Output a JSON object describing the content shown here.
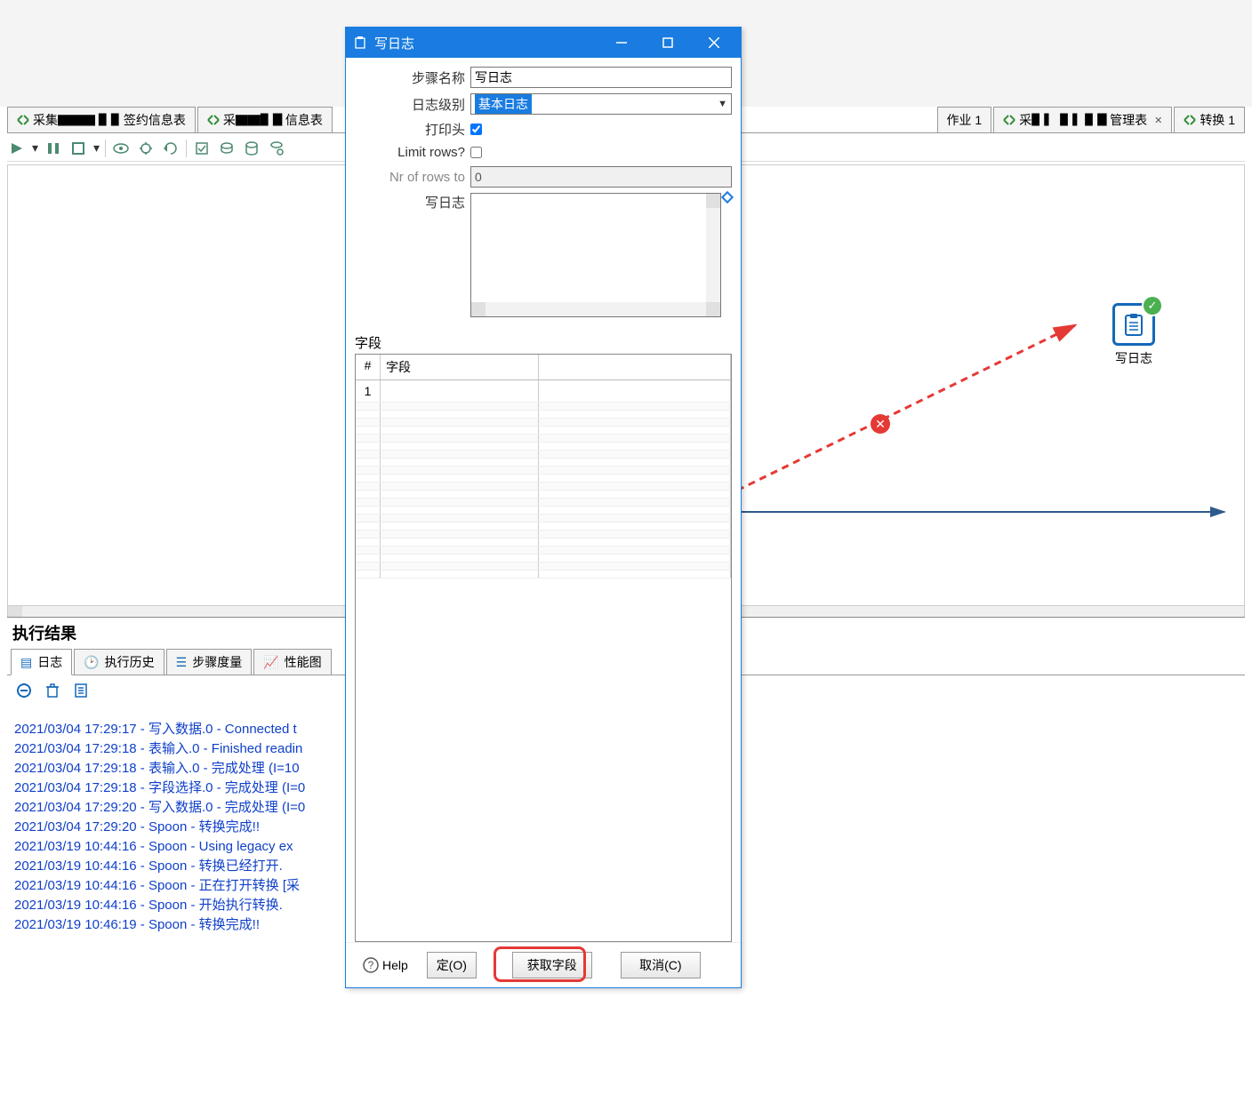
{
  "dialog": {
    "title": "写日志",
    "step_name_label": "步骤名称",
    "step_name_value": "写日志",
    "log_level_label": "日志级别",
    "log_level_value": "基本日志",
    "print_header_label": "打印头",
    "print_header_checked": true,
    "limit_rows_label": "Limit rows?",
    "limit_rows_checked": false,
    "nr_rows_label": "Nr of rows to",
    "nr_rows_value": "0",
    "write_log_label": "写日志",
    "fields_section_label": "字段",
    "grid": {
      "col_num_header": "#",
      "col_field_header": "字段",
      "rows": [
        {
          "num": "1",
          "field": ""
        }
      ]
    },
    "buttons": {
      "help": "Help",
      "ok": "定(O)",
      "get_fields": "获取字段",
      "cancel": "取消(C)"
    }
  },
  "tabs": {
    "t1": "采集▇▇▇ ▋▋签约信息表",
    "t2": "采▇▇▋▊信息表",
    "t3": "作业 1",
    "t4": "采▋▍ ▋▍▋▊管理表",
    "t5": "转换 1"
  },
  "canvas": {
    "node_label": "写日志"
  },
  "results": {
    "panel_title": "执行结果",
    "tabs": {
      "log": "日志",
      "history": "执行历史",
      "metrics": "步骤度量",
      "perf": "性能图"
    }
  },
  "log_lines": [
    "2021/03/04 17:29:17 - 写入数据.0 - Connected t",
    "2021/03/04 17:29:18 - 表输入.0 - Finished readin",
    "2021/03/04 17:29:18 - 表输入.0 - 完成处理 (I=10",
    "2021/03/04 17:29:18 - 字段选择.0 - 完成处理 (I=0",
    "2021/03/04 17:29:20 - 写入数据.0 - 完成处理 (I=0",
    "2021/03/04 17:29:20 - Spoon - 转换完成!!",
    "2021/03/19 10:44:16 - Spoon - Using legacy ex",
    "2021/03/19 10:44:16 - Spoon - 转换已经打开.",
    "2021/03/19 10:44:16 - Spoon - 正在打开转换 [采",
    "2021/03/19 10:44:16 - Spoon - 开始执行转换.",
    "2021/03/19 10:46:19 - Spoon - 转换完成!!"
  ]
}
